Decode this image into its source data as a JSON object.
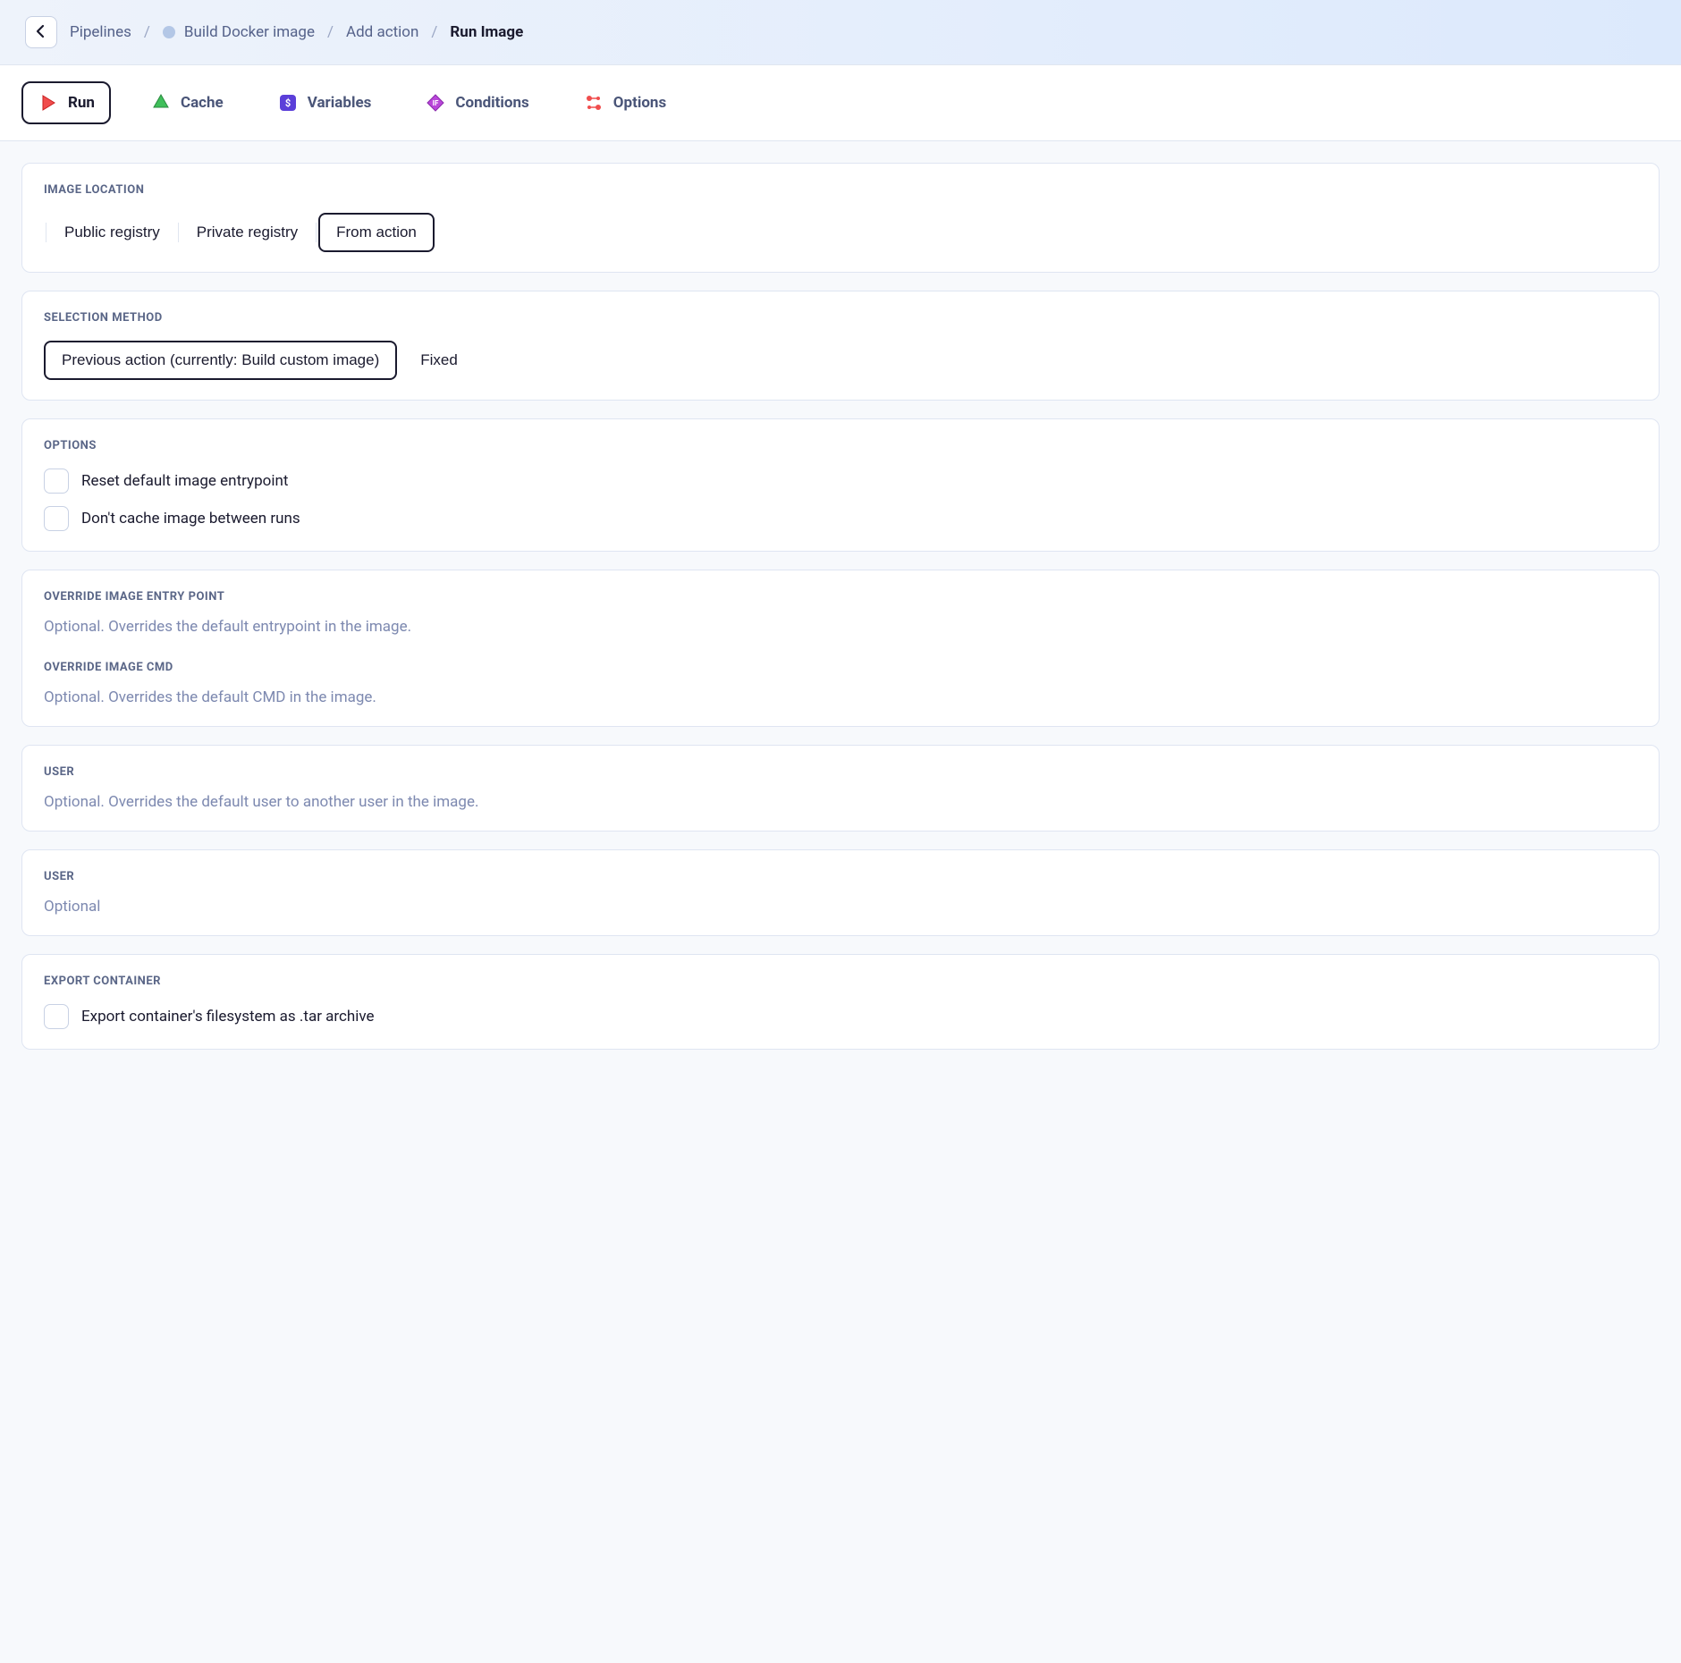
{
  "breadcrumbs": {
    "items": [
      {
        "label": "Pipelines"
      },
      {
        "label": "Build Docker image"
      },
      {
        "label": "Add action"
      },
      {
        "label": "Run Image"
      }
    ]
  },
  "tabs": {
    "run": "Run",
    "cache": "Cache",
    "variables": "Variables",
    "conditions": "Conditions",
    "options": "Options"
  },
  "sections": {
    "image_location": {
      "title": "IMAGE LOCATION",
      "options": {
        "public": "Public registry",
        "private": "Private registry",
        "from_action": "From action"
      }
    },
    "selection_method": {
      "title": "SELECTION METHOD",
      "options": {
        "previous": "Previous action (currently: Build custom image)",
        "fixed": "Fixed"
      }
    },
    "options_section": {
      "title": "OPTIONS",
      "reset_entrypoint": "Reset default image entrypoint",
      "dont_cache": "Don't cache image between runs"
    },
    "override_entry": {
      "title": "OVERRIDE IMAGE ENTRY POINT",
      "placeholder": "Optional. Overrides the default entrypoint in the image."
    },
    "override_cmd": {
      "title": "OVERRIDE IMAGE CMD",
      "placeholder": "Optional. Overrides the default CMD in the image."
    },
    "user1": {
      "title": "USER",
      "placeholder": "Optional. Overrides the default user to another user in the image."
    },
    "user2": {
      "title": "USER",
      "placeholder": "Optional"
    },
    "export": {
      "title": "EXPORT CONTAINER",
      "label": "Export container's filesystem as .tar archive"
    }
  }
}
